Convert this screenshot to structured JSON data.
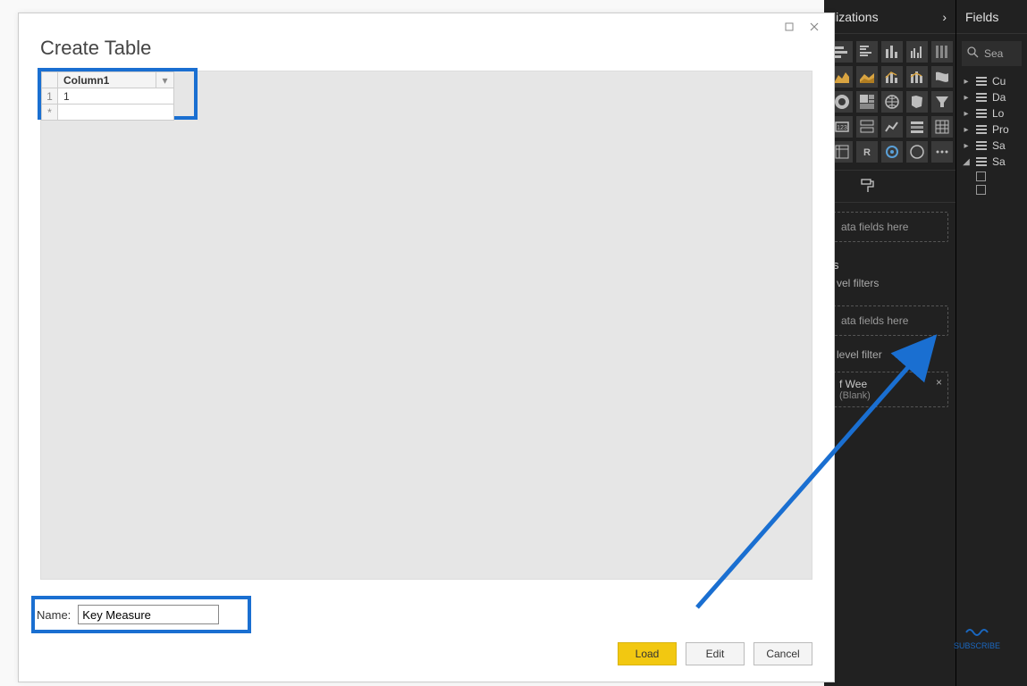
{
  "dialog": {
    "title": "Create Table",
    "columns": [
      "Column1"
    ],
    "rows": [
      {
        "index": "1",
        "values": [
          "1"
        ]
      },
      {
        "index": "*",
        "values": [
          ""
        ]
      }
    ],
    "name_label": "Name:",
    "name_value": "Key Measure",
    "buttons": {
      "load": "Load",
      "edit": "Edit",
      "cancel": "Cancel"
    }
  },
  "viz_panel": {
    "title": "lizations",
    "format_icon": "format",
    "values_dropzone": "ata fields here",
    "filters_section": "s",
    "level_filters_text": "vel filters",
    "drag_text": "ata fields here",
    "level_filter_text": " level filter",
    "filter_card_line1": "f Wee",
    "filter_card_line2": "(Blank)"
  },
  "fields_panel": {
    "title": "Fields",
    "search_placeholder": "Sea",
    "tables": [
      {
        "expanded": false,
        "name": "Cu"
      },
      {
        "expanded": false,
        "name": "Da"
      },
      {
        "expanded": false,
        "name": "Lo"
      },
      {
        "expanded": false,
        "name": "Pro"
      },
      {
        "expanded": false,
        "name": "Sa"
      },
      {
        "expanded": true,
        "name": "Sa"
      }
    ]
  },
  "annotation": {
    "subscribe": "SUBSCRIBE"
  }
}
